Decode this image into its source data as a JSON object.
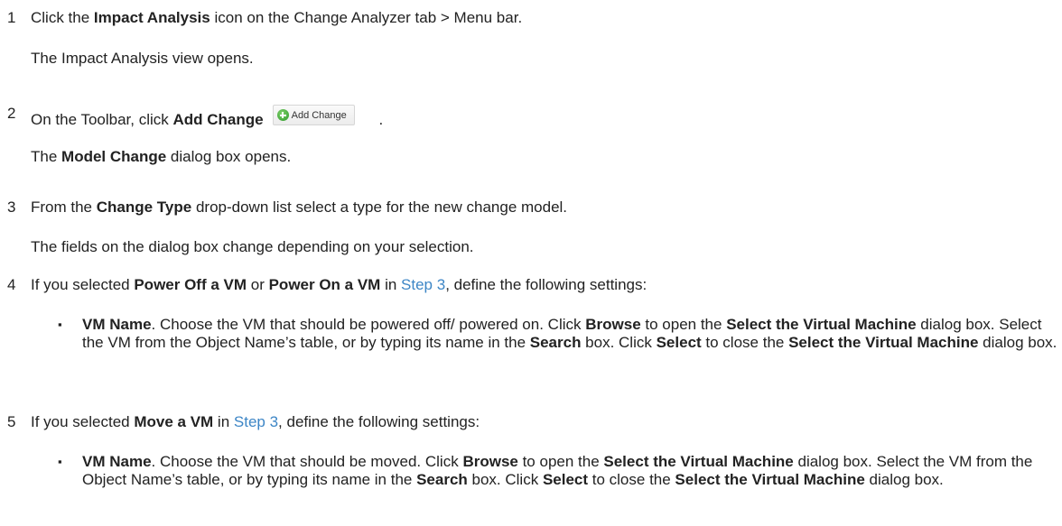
{
  "steps": [
    {
      "number": "1",
      "parts": [
        "Click the ",
        "Impact Analysis",
        " icon on the Change Analyzer tab > Menu bar."
      ],
      "result": "The Impact Analysis view opens."
    },
    {
      "number": "2",
      "parts": [
        "On the Toolbar, click ",
        "Add Change",
        " ."
      ],
      "button_label": "Add Change",
      "result_parts": [
        "The ",
        "Model Change",
        " dialog box opens."
      ]
    },
    {
      "number": "3",
      "parts": [
        "From the ",
        "Change Type",
        " drop-down list select a type for the new change model."
      ],
      "result": "The fields on the dialog box change depending on your selection."
    },
    {
      "number": "4",
      "parts": [
        "If you selected ",
        "Power Off a VM",
        " or ",
        "Power On a VM",
        " in ",
        "Step 3",
        ", define the following settings:"
      ],
      "bullet": {
        "marker": "▪",
        "parts": [
          "VM Name",
          ". Choose the VM that should be powered off/ powered on. Click ",
          "Browse",
          " to open the ",
          "Select the Virtual Machine",
          " dialog box. Select the VM from the Object Name’s table, or by typing its name in the ",
          "Search",
          " box. Click ",
          "Select",
          " to close the ",
          "Select the Virtual Machine",
          " dialog box."
        ]
      }
    },
    {
      "number": "5",
      "parts": [
        "If you selected ",
        "Move a VM",
        " in ",
        "Step 3",
        ", define the following settings:"
      ],
      "bullet": {
        "marker": "▪",
        "parts": [
          "VM Name",
          ". Choose the VM that should be moved. Click ",
          "Browse",
          " to open the ",
          "Select the Virtual Machine",
          " dialog box. Select the VM from the Object Name’s table, or by typing its name in the ",
          "Search",
          " box. Click ",
          "Select",
          " to close the ",
          "Select the Virtual Machine",
          " dialog box."
        ]
      }
    }
  ],
  "colors": {
    "text": "#222222",
    "link": "#3d86c6",
    "button_icon": "add-circle-green"
  }
}
